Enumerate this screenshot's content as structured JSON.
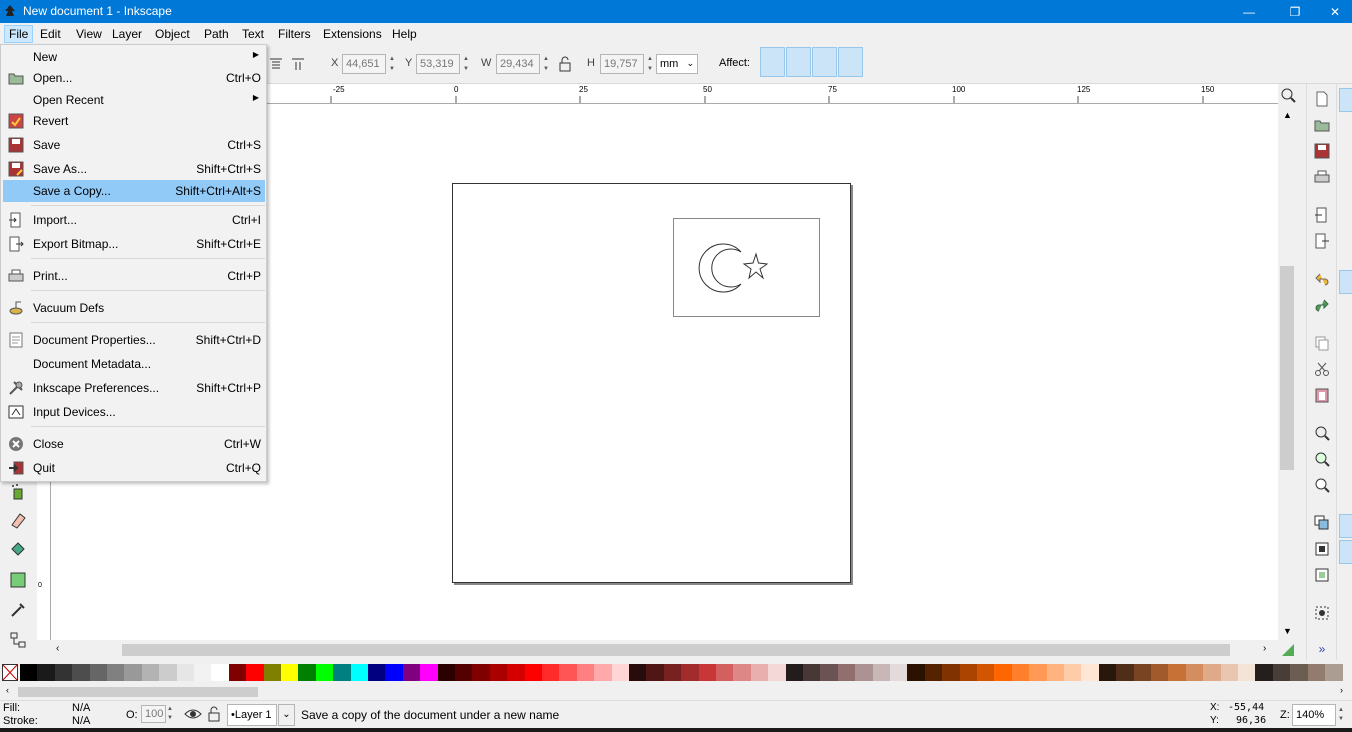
{
  "window": {
    "title": "New document 1 - Inkscape",
    "minimize": "—",
    "restore": "❐",
    "close": "✕"
  },
  "menubar": [
    "File",
    "Edit",
    "View",
    "Layer",
    "Object",
    "Path",
    "Text",
    "Filters",
    "Extensions",
    "Help"
  ],
  "controls": {
    "x_label": "X",
    "x_value": "44,651",
    "y_label": "Y",
    "y_value": "53,319",
    "w_label": "W",
    "w_value": "29,434",
    "h_label": "H",
    "h_value": "19,757",
    "unit": "mm",
    "affect_label": "Affect:"
  },
  "ruler": {
    "h_ticks": [
      "-25",
      "0",
      "25",
      "50",
      "75",
      "100",
      "125",
      "150"
    ],
    "v_tick": "0"
  },
  "file_menu": {
    "items": [
      {
        "label": "New",
        "shortcut": "",
        "submenu": true,
        "icon": ""
      },
      {
        "label": "Open...",
        "shortcut": "Ctrl+O",
        "icon": "open-folder-icon"
      },
      {
        "label": "Open Recent",
        "shortcut": "",
        "submenu": true,
        "icon": ""
      },
      {
        "label": "Revert",
        "shortcut": "",
        "icon": "revert-icon"
      },
      {
        "label": "Save",
        "shortcut": "Ctrl+S",
        "icon": "save-icon"
      },
      {
        "label": "Save As...",
        "shortcut": "Shift+Ctrl+S",
        "icon": "save-as-icon"
      },
      {
        "label": "Save a Copy...",
        "shortcut": "Shift+Ctrl+Alt+S",
        "icon": "",
        "highlighted": true
      },
      {
        "label": "Import...",
        "shortcut": "Ctrl+I",
        "icon": "import-icon"
      },
      {
        "label": "Export Bitmap...",
        "shortcut": "Shift+Ctrl+E",
        "icon": "export-icon"
      },
      {
        "label": "Print...",
        "shortcut": "Ctrl+P",
        "icon": "print-icon"
      },
      {
        "label": "Vacuum Defs",
        "shortcut": "",
        "icon": "vacuum-icon"
      },
      {
        "label": "Document Properties...",
        "shortcut": "Shift+Ctrl+D",
        "icon": "document-properties-icon"
      },
      {
        "label": "Document Metadata...",
        "shortcut": "",
        "icon": ""
      },
      {
        "label": "Inkscape Preferences...",
        "shortcut": "Shift+Ctrl+P",
        "icon": "preferences-icon"
      },
      {
        "label": "Input Devices...",
        "shortcut": "",
        "icon": "input-devices-icon"
      },
      {
        "label": "Close",
        "shortcut": "Ctrl+W",
        "icon": "close-icon"
      },
      {
        "label": "Quit",
        "shortcut": "Ctrl+Q",
        "icon": "quit-icon"
      }
    ]
  },
  "palette": {
    "colors": [
      "#000000",
      "#1a1a1a",
      "#333333",
      "#4d4d4d",
      "#666666",
      "#808080",
      "#999999",
      "#b3b3b3",
      "#cccccc",
      "#e6e6e6",
      "#f2f2f2",
      "#ffffff",
      "#800000",
      "#ff0000",
      "#808000",
      "#ffff00",
      "#008000",
      "#00ff00",
      "#008080",
      "#00ffff",
      "#000080",
      "#0000ff",
      "#800080",
      "#ff00ff",
      "#2b0000",
      "#550000",
      "#800000",
      "#aa0000",
      "#d40000",
      "#ff0000",
      "#ff2a2a",
      "#ff5555",
      "#ff8080",
      "#ffaaaa",
      "#ffd5d5",
      "#280b0b",
      "#501616",
      "#782121",
      "#a02c2c",
      "#c83737",
      "#d35f5f",
      "#de8787",
      "#e9afaf",
      "#f4d7d7",
      "#241c1c",
      "#483737",
      "#6c5353",
      "#916f6f",
      "#ac9393",
      "#c8b7b7",
      "#e3dbdb",
      "#2b1100",
      "#552200",
      "#803300",
      "#aa4400",
      "#d45500",
      "#ff6600",
      "#ff7f2a",
      "#ff9955",
      "#ffb380",
      "#ffccaa",
      "#ffe6d5",
      "#28170b",
      "#502d16",
      "#784421",
      "#a05a2c",
      "#c87137",
      "#d38d5f",
      "#deaa87",
      "#e9c6af",
      "#f4e3d7",
      "#241f1c",
      "#483e37",
      "#6c5d53",
      "#917c6f",
      "#ac9d93"
    ]
  },
  "status": {
    "fill_label": "Fill:",
    "fill_value": "N/A",
    "stroke_label": "Stroke:",
    "stroke_value": "N/A",
    "opacity_label": "O:",
    "opacity_value": "100",
    "layer": "•Layer 1",
    "message": "Save a copy of the document under a new name",
    "x_label": "X:",
    "x_value": "-55,44",
    "y_label": "Y:",
    "y_value": "96,36",
    "zoom_label": "Z:",
    "zoom_value": "140%"
  }
}
